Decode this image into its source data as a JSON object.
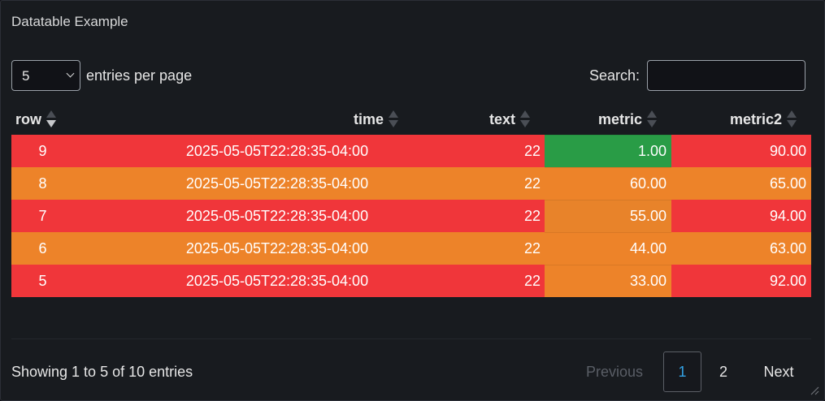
{
  "panel": {
    "title": "Datatable Example"
  },
  "length": {
    "value": "5",
    "label": "entries per page"
  },
  "search": {
    "label": "Search:",
    "placeholder": ""
  },
  "columns": [
    {
      "key": "row",
      "label": "row"
    },
    {
      "key": "time",
      "label": "time"
    },
    {
      "key": "text",
      "label": "text"
    },
    {
      "key": "metric",
      "label": "metric"
    },
    {
      "key": "metric2",
      "label": "metric2"
    }
  ],
  "rows": [
    {
      "row": "9",
      "time": "2025-05-05T22:28:35-04:00",
      "text": "22",
      "metric": "1.00",
      "metric2": "90.00",
      "row_color": "#f0363a",
      "metric_color": "#299c46"
    },
    {
      "row": "8",
      "time": "2025-05-05T22:28:35-04:00",
      "text": "22",
      "metric": "60.00",
      "metric2": "65.00",
      "row_color": "#ed8329",
      "metric_color": "#ed8329"
    },
    {
      "row": "7",
      "time": "2025-05-05T22:28:35-04:00",
      "text": "22",
      "metric": "55.00",
      "metric2": "94.00",
      "row_color": "#f0363a",
      "metric_color": "#e8832a"
    },
    {
      "row": "6",
      "time": "2025-05-05T22:28:35-04:00",
      "text": "22",
      "metric": "44.00",
      "metric2": "63.00",
      "row_color": "#ed8329",
      "metric_color": "#ed8329"
    },
    {
      "row": "5",
      "time": "2025-05-05T22:28:35-04:00",
      "text": "22",
      "metric": "33.00",
      "metric2": "92.00",
      "row_color": "#f0363a",
      "metric_color": "#ed8329"
    }
  ],
  "footer": {
    "info": "Showing 1 to 5 of 10 entries",
    "previous": "Previous",
    "pages": [
      "1",
      "2"
    ],
    "next": "Next"
  },
  "colors": {
    "accent": "#33a2e5",
    "red": "#f0363a",
    "orange": "#ed8329",
    "green": "#299c46"
  }
}
